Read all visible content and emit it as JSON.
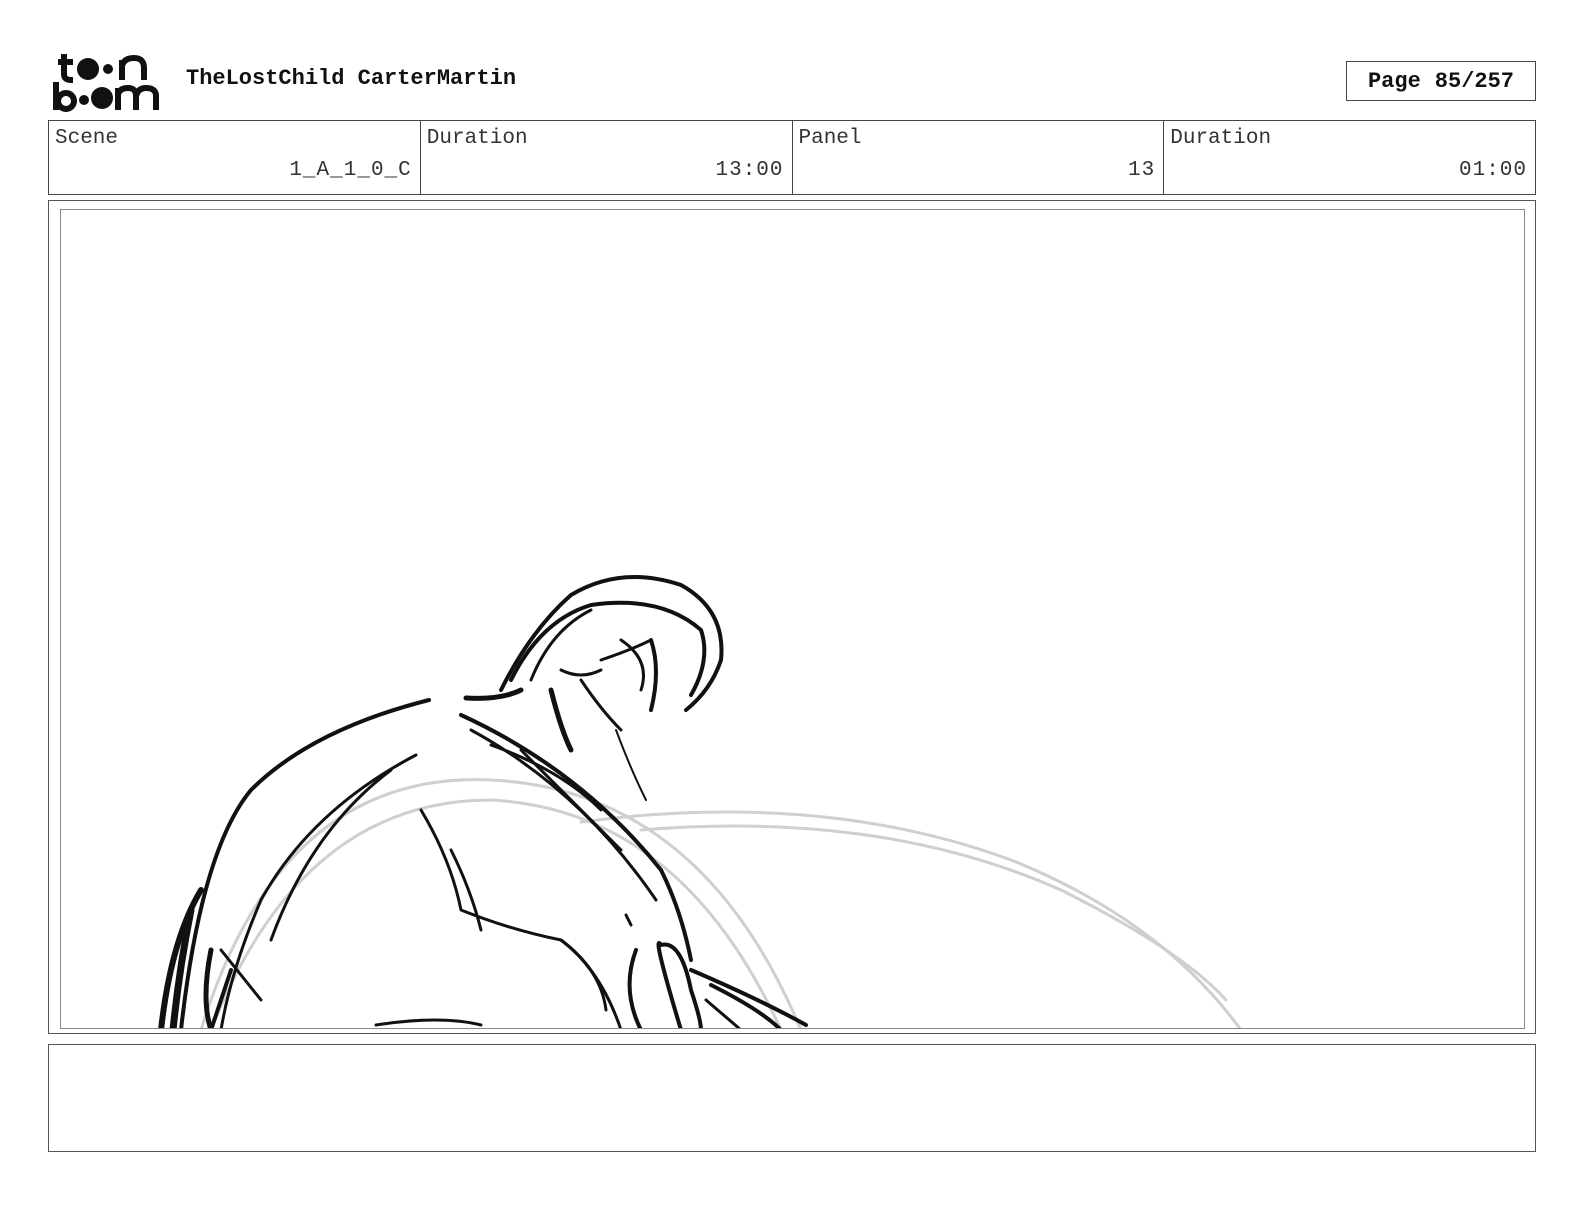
{
  "header": {
    "logo_text": "toon boom",
    "project_title": "TheLostChild CarterMartin",
    "page_label": "Page",
    "page_value": "85/257"
  },
  "info": {
    "scene_label": "Scene",
    "scene_value": "1_A_1_0_C",
    "scene_duration_label": "Duration",
    "scene_duration_value": "13:00",
    "panel_label": "Panel",
    "panel_value": "13",
    "panel_duration_label": "Duration",
    "panel_duration_value": "01:00"
  },
  "panel": {
    "image_description_icon": "rough-sketch-figure"
  },
  "notes": {
    "text": ""
  },
  "colors": {
    "sketch_dark": "#111111",
    "sketch_light": "#cfcfcf",
    "border": "#444444"
  }
}
